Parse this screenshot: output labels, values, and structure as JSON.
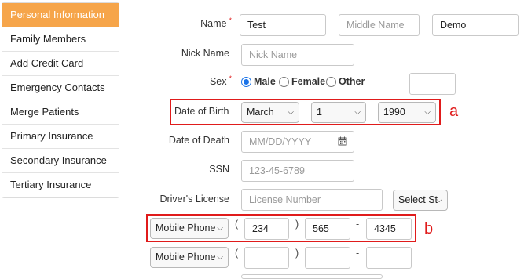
{
  "sidebar": {
    "items": [
      {
        "label": "Personal Information"
      },
      {
        "label": "Family Members"
      },
      {
        "label": "Add Credit Card"
      },
      {
        "label": "Emergency Contacts"
      },
      {
        "label": "Merge Patients"
      },
      {
        "label": "Primary Insurance"
      },
      {
        "label": "Secondary Insurance"
      },
      {
        "label": "Tertiary Insurance"
      }
    ],
    "active_color": "#f6a54a"
  },
  "form": {
    "name": {
      "label": "Name",
      "required": "*",
      "first": "Test",
      "middle_placeholder": "Middle Name",
      "last": "Demo"
    },
    "nickname": {
      "label": "Nick Name",
      "placeholder": "Nick Name"
    },
    "sex": {
      "label": "Sex",
      "required": "*",
      "options": [
        "Male",
        "Female",
        "Other"
      ],
      "selected": "Male"
    },
    "dob": {
      "label": "Date of Birth",
      "month": "March",
      "day": "1",
      "year": "1990"
    },
    "dod": {
      "label": "Date of Death",
      "placeholder": "MM/DD/YYYY"
    },
    "ssn": {
      "label": "SSN",
      "placeholder": "123-45-6789"
    },
    "license": {
      "label": "Driver's License",
      "placeholder": "License Number",
      "state": "Select St"
    },
    "phone1": {
      "type": "Mobile Phone",
      "area": "234",
      "prefix": "565",
      "line": "4345",
      "open_paren": "(",
      "close_paren": ")",
      "dash": "-"
    },
    "phone2": {
      "type": "Mobile Phone",
      "area": "",
      "prefix": "",
      "line": "",
      "open_paren": "(",
      "close_paren": ")",
      "dash": "-"
    }
  },
  "annotations": {
    "a": "a",
    "b": "b",
    "highlight_color": "#e01b1b"
  }
}
